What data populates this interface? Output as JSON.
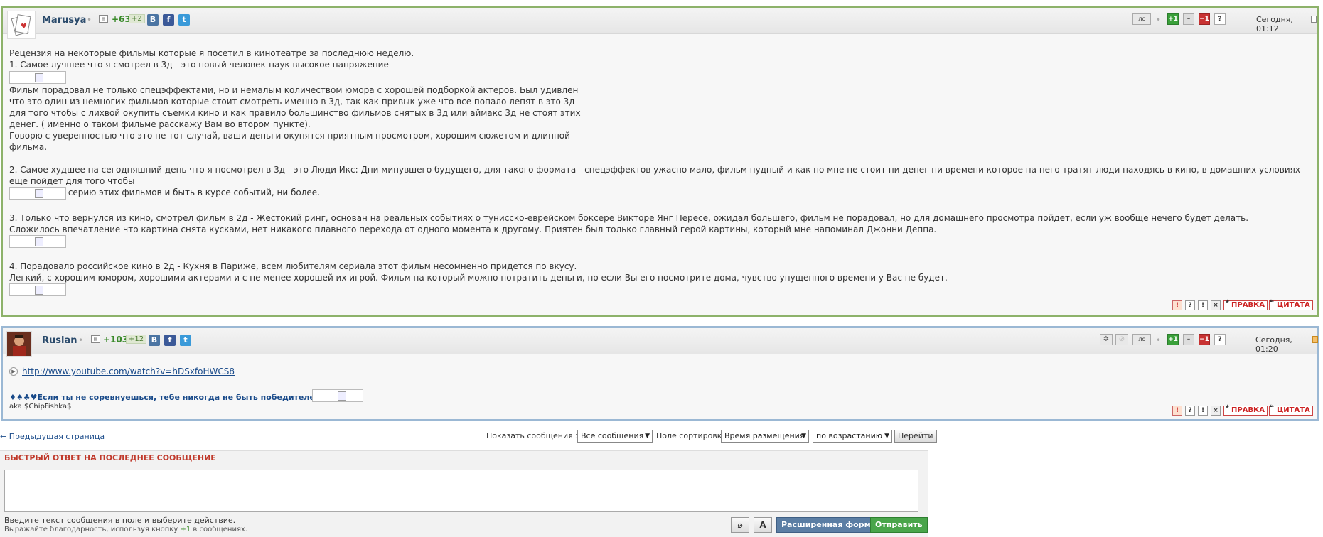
{
  "post1": {
    "author": "Marusya",
    "rep": "+63",
    "rep_small": "+2",
    "social": {
      "vk": "B",
      "fb": "f",
      "tw": "t"
    },
    "btn_ls": "лс",
    "btn_plus": "+1",
    "btn_dash": "–",
    "btn_minus": "−1",
    "btn_q": "?",
    "date": "Сегодня, 01:12",
    "lines": {
      "l1": "Рецензия на некоторые фильмы которые я посетил в кинотеатре за последнюю неделю.",
      "l2": "1. Самое лучшее что я смотрел в 3д - это новый человек-паук высокое напряжение",
      "p1": "Фильм порадовал не только спецэффектами, но и немалым количеством юмора с хорошей подборкой актеров. Был удивлен\nчто это один из немногих фильмов которые стоит смотреть именно в 3д, так как привык уже что все попало лепят в это 3д\nдля того чтобы с лихвой окупить съемки кино и как правило большинство фильмов снятых в 3д или аймакс 3д не стоят этих\nденег. ( именно о таком фильме расскажу Вам во втором пункте).\nГоворю с уверенностью что это не тот случай, ваши деньги окупятся приятным просмотром, хорошим сюжетом и длинной\nфильма.",
      "p2": "2. Самое худшее на сегодняшний день что я посмотрел в 3д - это Люди Икс: Дни минувшего будущего, для такого формата - спецэффектов ужасно мало, фильм нудный и как по мне не стоит ни денег ни времени которое на него тратят люди находясь в кино, в домашних условиях еще пойдет для того чтобы\nподдержать серию этих фильмов и быть в курсе событий, ни более.",
      "p3": "3. Только что вернулся из кино, смотрел фильм в 2д - Жестокий ринг, основан на реальных событиях о тунисско-еврейском боксере Викторе Янг Пересе, ожидал большего, фильм не порадовал, но для домашнего просмотра пойдет, если уж вообще нечего будет делать.\nСложилось впечатление что картина снята кусками, нет никакого плавного перехода от одного момента к другому. Приятен был только главный герой картины, который мне напоминал Джонни Деппа.",
      "p4": "4. Порадовало российское кино в 2д - Кухня в Париже, всем любителям сериала этот фильм несомненно придется по вкусу.\nЛегкий, с хорошим юмором, хорошими актерами и с не менее хорошей их игрой. Фильм на который можно потратить деньги, но если Вы его посмотрите дома, чувство упущенного времени у Вас не будет."
    },
    "act": {
      "warn1": "!",
      "warn2": "?",
      "warn3": "!",
      "x": "×",
      "edit": "ПРАВКА",
      "quote": "ЦИТАТА"
    }
  },
  "post2": {
    "author": "Ruslan",
    "rep": "+103",
    "rep_small": "+12",
    "social": {
      "vk": "B",
      "fb": "f",
      "tw": "t"
    },
    "btn_ls": "лс",
    "btn_plus": "+1",
    "btn_dash": "–",
    "btn_minus": "−1",
    "btn_q": "?",
    "date": "Сегодня, 01:20",
    "link": "http://www.youtube.com/watch?v=hDSxfoHWCS8",
    "signature": "♦♠♣♥Если ты не соревнуешься, тебе никогда не быть победителем ♥♣♠♦",
    "aka": "aka $ChipFishka$",
    "act": {
      "warn1": "!",
      "warn2": "?",
      "warn3": "!",
      "x": "×",
      "edit": "ПРАВКА",
      "quote": "ЦИТАТА"
    }
  },
  "nav": {
    "prev": "← Предыдущая страница",
    "show_label": "Показать сообщения за:",
    "show_value": "Все сообщения",
    "sort_label": "Поле сортировки",
    "sort_value": "Время размещения",
    "order_value": "по возрастанию",
    "go": "Перейти"
  },
  "quick_reply": {
    "title": "БЫСТРЫЙ ОТВЕТ НА ПОСЛЕДНЕЕ СООБЩЕНИЕ",
    "hint1": "Введите текст сообщения в поле и выберите действие.",
    "hint2_a": "Выражайте благодарность, используя кнопку ",
    "hint2_b": "+1",
    "hint2_c": " в сообщениях.",
    "tool_font": "A",
    "ext_label": "Расширенная форма",
    "send_label": "Отправить"
  }
}
